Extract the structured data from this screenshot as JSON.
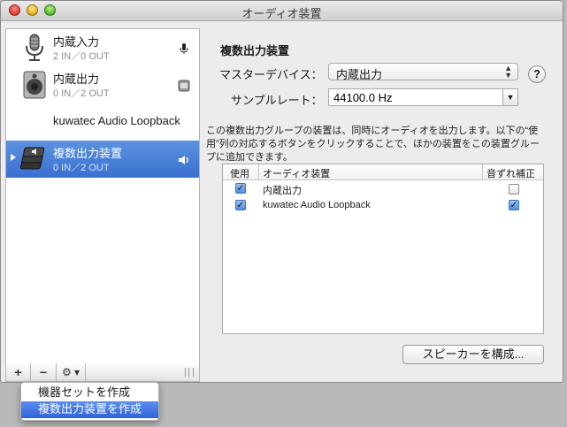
{
  "window": {
    "title": "オーディオ装置"
  },
  "devices": [
    {
      "name": "内蔵入力",
      "io": "2 IN／0 OUT",
      "icon": "microphone-icon",
      "badge": "microphone-badge-icon"
    },
    {
      "name": "内蔵出力",
      "io": "0 IN／2 OUT",
      "icon": "speaker-icon",
      "badge": "finder-badge-icon"
    },
    {
      "name": "kuwatec Audio Loopback",
      "io": "",
      "icon": "",
      "badge": ""
    },
    {
      "name": "複数出力装置",
      "io": "0 IN／2 OUT",
      "icon": "aggregate-device-icon",
      "badge": "volume-icon",
      "selected": true
    }
  ],
  "sidebar_toolbar": {
    "add": "+",
    "remove": "−",
    "gear": "⚙ ▾"
  },
  "main": {
    "title": "複数出力装置",
    "master_label": "マスターデバイス：",
    "master_value": "内蔵出力",
    "rate_label": "サンプルレート：",
    "rate_value": "44100.0 Hz",
    "help": "?",
    "description": "この複数出力グループの装置は、同時にオーディオを出力します。以下の“使用”列の対応するボタンをクリックすることで、ほかの装置をこの装置グループに追加できます。"
  },
  "table": {
    "headers": [
      "使用",
      "オーディオ装置",
      "音ずれ補正"
    ],
    "rows": [
      {
        "use": true,
        "name": "内蔵出力",
        "drift": false
      },
      {
        "use": true,
        "name": "kuwatec Audio Loopback",
        "drift": true
      }
    ]
  },
  "configure_button": "スピーカーを構成...",
  "popup_menu": {
    "items": [
      "機器セットを作成",
      "複数出力装置を作成"
    ],
    "highlighted": 1
  },
  "colors": {
    "selection": "#3a6fcf",
    "menu_highlight": "#2f62d9"
  }
}
